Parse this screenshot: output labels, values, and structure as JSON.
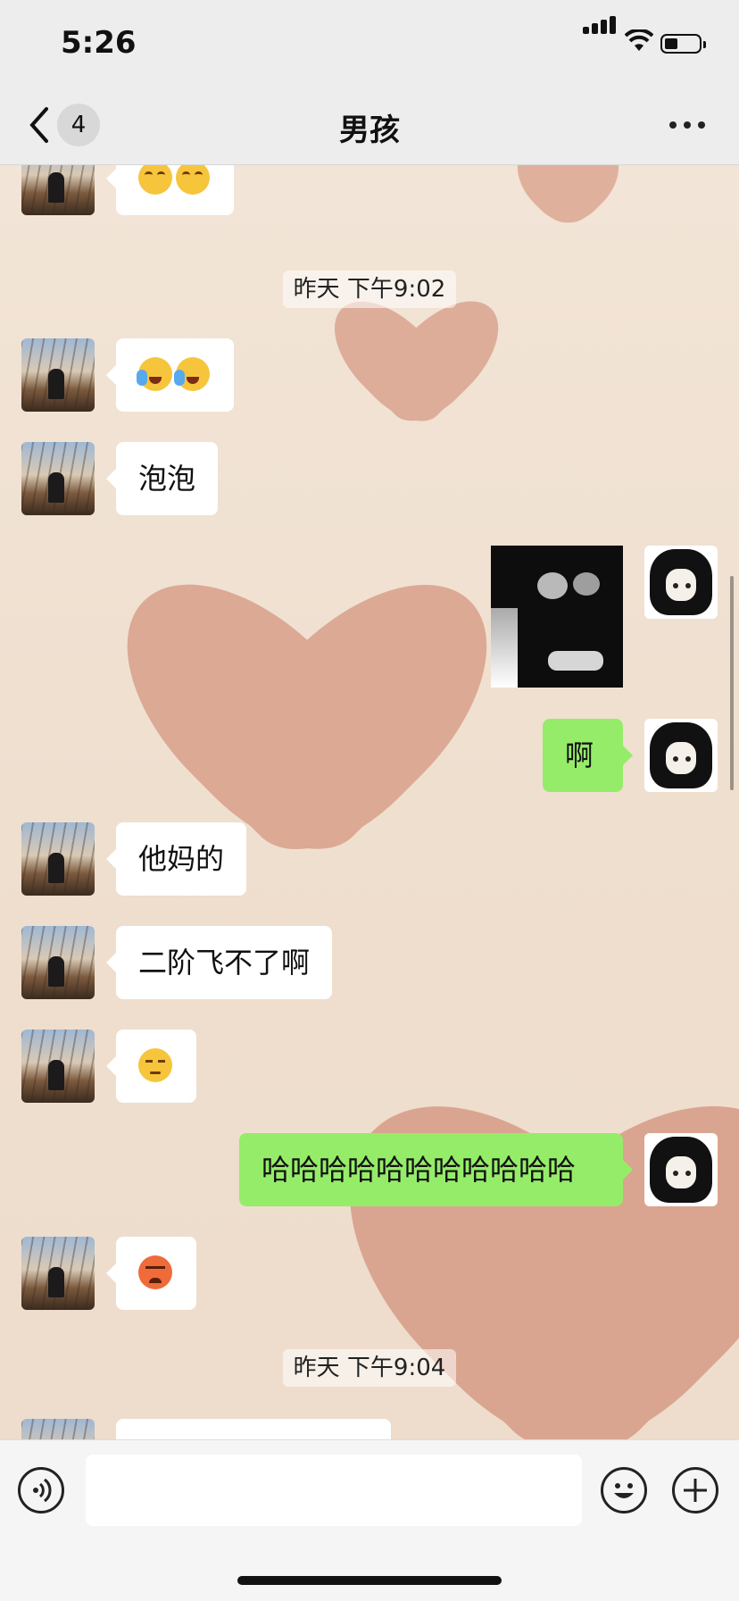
{
  "status_bar": {
    "time": "5:26"
  },
  "nav": {
    "back_count": "4",
    "title": "男孩"
  },
  "messages": {
    "m0": {
      "side": "left",
      "content": "emoji",
      "emojis": [
        "smirk",
        "smirk"
      ]
    },
    "ts1": "昨天 下午9:02",
    "m1": {
      "side": "left",
      "content": "emoji",
      "emojis": [
        "laugh-cry",
        "laugh-cry"
      ]
    },
    "m2": {
      "side": "left",
      "text": "泡泡"
    },
    "m3": {
      "side": "right",
      "content": "image"
    },
    "m4": {
      "side": "right",
      "text": "啊"
    },
    "m5": {
      "side": "left",
      "text": "他妈的"
    },
    "m6": {
      "side": "left",
      "text": "二阶飞不了啊"
    },
    "m7": {
      "side": "left",
      "content": "emoji",
      "emojis": [
        "unamused"
      ]
    },
    "m8": {
      "side": "right",
      "text": "哈哈哈哈哈哈哈哈哈哈哈"
    },
    "m9": {
      "side": "left",
      "content": "emoji",
      "emojis": [
        "angry"
      ]
    },
    "ts2": "昨天 下午9:04"
  },
  "colors": {
    "my_bubble": "#95ec69",
    "their_bubble": "#ffffff",
    "bar_bg": "#ededed"
  }
}
